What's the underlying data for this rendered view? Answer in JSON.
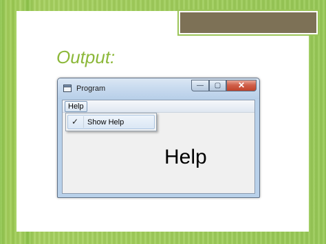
{
  "slide": {
    "title": "Output:"
  },
  "window": {
    "title": "Program",
    "controls": {
      "minimize": "—",
      "maximize": "▢",
      "close": "✕"
    },
    "menubar": {
      "help_menu": "Help"
    },
    "dropdown": {
      "item_label": "Show Help",
      "item_checked_glyph": "✓"
    },
    "content": {
      "label": "Help"
    }
  },
  "colors": {
    "accent_green": "#8cb83a",
    "top_box": "#7d7156",
    "close_button": "#c8503a"
  }
}
